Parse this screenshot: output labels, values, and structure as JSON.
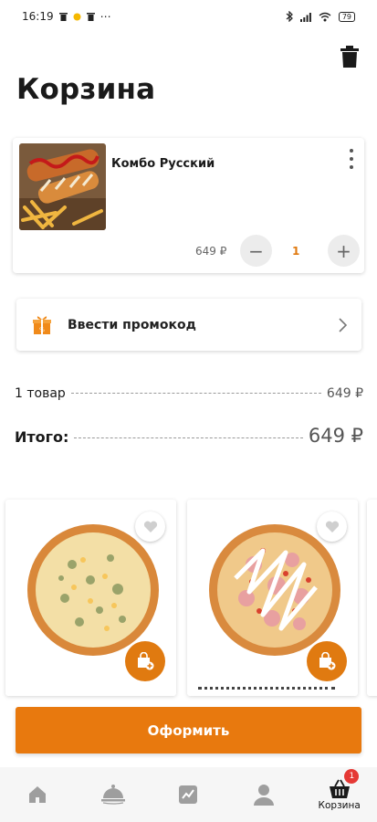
{
  "status_bar": {
    "time": "16:19",
    "more": "⋯",
    "battery": "79"
  },
  "page": {
    "title": "Корзина"
  },
  "cart": {
    "items": [
      {
        "name": "Комбо Русский",
        "price": "649 ₽",
        "quantity": "1"
      }
    ],
    "minus_label": "−",
    "plus_label": "+"
  },
  "promo": {
    "label": "Ввести промокод"
  },
  "summary": {
    "count_label": "1 товар",
    "count_value": "649 ₽",
    "total_label": "Итого:",
    "total_value": "649 ₽"
  },
  "checkout": {
    "label": "Оформить"
  },
  "bottom_nav": {
    "items": [
      {
        "icon": "home-icon",
        "label": ""
      },
      {
        "icon": "cloche-icon",
        "label": ""
      },
      {
        "icon": "chart-icon",
        "label": ""
      },
      {
        "icon": "profile-icon",
        "label": ""
      },
      {
        "icon": "basket-icon",
        "label": "Корзина",
        "badge": "1"
      }
    ]
  },
  "colors": {
    "accent": "#e8790e",
    "badge": "#e53935",
    "qty_value": "#e07a10"
  }
}
